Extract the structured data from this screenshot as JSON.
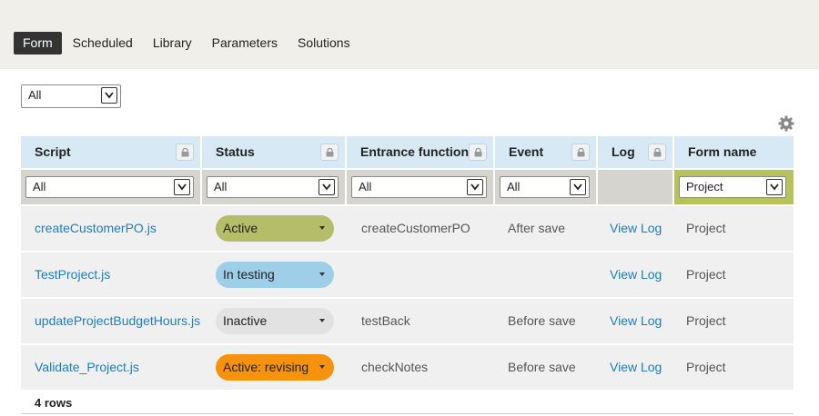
{
  "tabs": [
    {
      "label": "Form",
      "active": true
    },
    {
      "label": "Scheduled",
      "active": false
    },
    {
      "label": "Library",
      "active": false
    },
    {
      "label": "Parameters",
      "active": false
    },
    {
      "label": "Solutions",
      "active": false
    }
  ],
  "top_filter": {
    "value": "All"
  },
  "settings_icon": "gear-icon",
  "columns": [
    {
      "label": "Script",
      "lock": true,
      "filter": "All"
    },
    {
      "label": "Status",
      "lock": true,
      "filter": "All"
    },
    {
      "label": "Entrance function",
      "lock": true,
      "filter": "All"
    },
    {
      "label": "Event",
      "lock": true,
      "filter": "All"
    },
    {
      "label": "Log",
      "lock": true,
      "filter": null
    },
    {
      "label": "Form name",
      "lock": false,
      "filter": "Project"
    }
  ],
  "rows": [
    {
      "script": "createCustomerPO.js",
      "status": "Active",
      "status_color": "#b5bd68",
      "entrance": "createCustomerPO",
      "event": "After save",
      "log": "View Log",
      "form": "Project"
    },
    {
      "script": "TestProject.js",
      "status": "In testing",
      "status_color": "#9fcfe8",
      "entrance": "",
      "event": "",
      "log": "View Log",
      "form": "Project"
    },
    {
      "script": "updateProjectBudgetHours.js",
      "status": "Inactive",
      "status_color": "#e2e2e2",
      "entrance": "testBack",
      "event": "Before save",
      "log": "View Log",
      "form": "Project"
    },
    {
      "script": "Validate_Project.js",
      "status": "Active: revising",
      "status_color": "#f5930e",
      "entrance": "checkNotes",
      "event": "Before save",
      "log": "View Log",
      "form": "Project"
    }
  ],
  "footer": {
    "row_count": "4 rows"
  },
  "colors": {
    "header_bg": "#d6e9f5",
    "filter_bg": "#d6d4cf",
    "active_filter_bg": "#b7c25a",
    "link": "#1a7fc0"
  }
}
